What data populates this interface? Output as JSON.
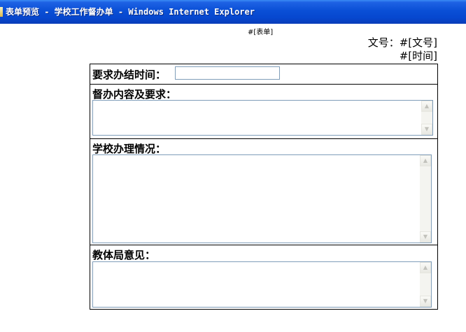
{
  "window": {
    "title": "表单预览 - 学校工作督办单 - Windows Internet Explorer"
  },
  "document": {
    "form_tag": "#[表单]",
    "doc_number": "文号：#[文号]",
    "time": "#[时间]"
  },
  "form": {
    "deadline_label": "要求办结时间：",
    "deadline_value": "",
    "content_label": "督办内容及要求：",
    "content_value": "",
    "handling_label": "学校办理情况：",
    "handling_value": "",
    "opinion_label": "教体局意见：",
    "opinion_value": ""
  },
  "icons": {
    "scroll_up": "scroll-up-arrow-icon",
    "scroll_down": "scroll-down-arrow-icon"
  }
}
